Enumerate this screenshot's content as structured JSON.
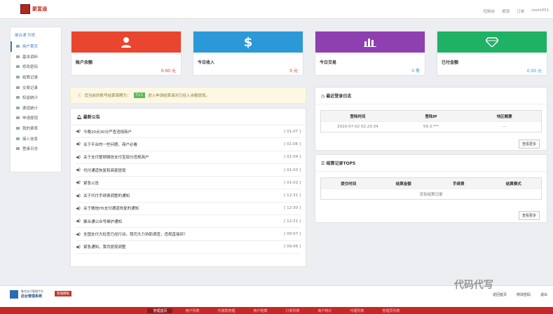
{
  "header": {
    "brand": "聚富通",
    "nav": [
      "控制台",
      "提现",
      "订单",
      "ceshi001"
    ]
  },
  "sidebar": {
    "title": "聚合通 列表",
    "items": [
      "用户首页",
      "基本资料",
      "修改密码",
      "结算记录",
      "交易记录",
      "权益统计",
      "渠道统计",
      "申请提现",
      "我的费率",
      "接入信息",
      "登录日志"
    ]
  },
  "cards": [
    {
      "label": "账户余额",
      "value": "0.00 元",
      "icon": "user-icon",
      "color": "#e9452f"
    },
    {
      "label": "今日收入",
      "value": "0 元",
      "icon": "dollar-icon",
      "color": "#2b99d7"
    },
    {
      "label": "今日交易",
      "value": "0 笔",
      "icon": "bar-chart-icon",
      "color": "#8e3fb0"
    },
    {
      "label": "已付金额",
      "value": "0.00 元",
      "icon": "diamond-icon",
      "color": "#1fb265"
    }
  ],
  "notice": {
    "text_before": "您当前的账号结算周期为：",
    "tag": "T+1",
    "text_after": "进入申请结算请对已经入余额提现。"
  },
  "announcements": {
    "title": "最新公告",
    "items": [
      {
        "text": "今晚20点30分严查违规商户",
        "date": "[ 01-07 ]"
      },
      {
        "text": "关于平台的一些问题、商户必看",
        "date": "[ 01-06 ]"
      },
      {
        "text": "关于支付整顿微信支付宝部分违规商户",
        "date": "[ 01-04 ]"
      },
      {
        "text": "代付通道恢复和商家提现",
        "date": "[ 01-03 ]"
      },
      {
        "text": "紧急公告",
        "date": "[ 01-02 ]"
      },
      {
        "text": "关于代付手续费调整的通知",
        "date": "[ 12-31 ]"
      },
      {
        "text": "关于微信H5支付通道恢复的通知",
        "date": "[ 12-30 ]"
      },
      {
        "text": "聚合通公众号维护通知",
        "date": "[ 12-21 ]"
      },
      {
        "text": "全国支付大检查已经行动，我司大力协助调查，违规直接封！",
        "date": "[ 09-07 ]"
      },
      {
        "text": "紧急通知，我司提现调整",
        "date": "[ 09-06 ]"
      }
    ]
  },
  "login_log": {
    "title": "最近登录日志",
    "headers": [
      "登陆时间",
      "登陆IP",
      "地区概要"
    ],
    "rows": [
      [
        "2020-07-02 02:23:34",
        "59.3.***",
        "--"
      ]
    ],
    "more": "查看更多"
  },
  "settle": {
    "title": "结算记录TOP5",
    "headers": [
      "提交时间",
      "结算金额",
      "手续费",
      "结算模式"
    ],
    "empty": "没有结算记录",
    "more": "查看更多"
  },
  "footer": {
    "sub": "聚合支付管理平台",
    "name": "后台管理系统",
    "badge": "管理模板",
    "links": [
      "返回首页",
      "修改密码",
      "退出"
    ],
    "menu": [
      "管理首页",
      "用户列表",
      "代收款管理",
      "用户结算",
      "订单列表",
      "商户统计",
      "代理列表",
      "管理员列表"
    ]
  },
  "watermark": "代码代写"
}
